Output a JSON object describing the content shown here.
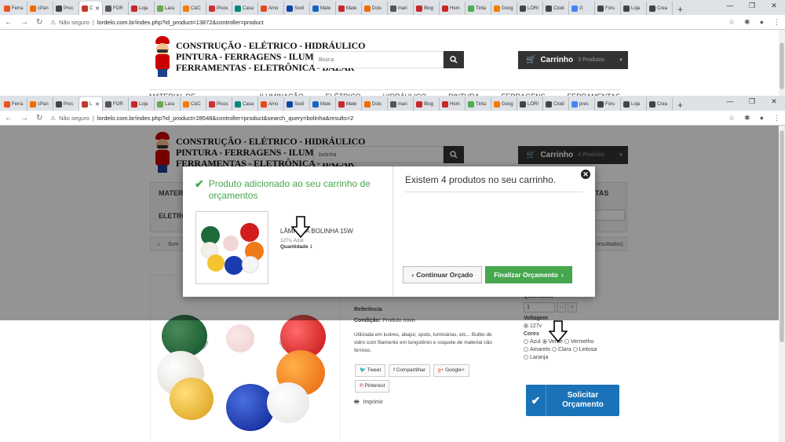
{
  "browser1": {
    "tabs": [
      {
        "label": "Ferra",
        "color": "#e8541e"
      },
      {
        "label": "cPan",
        "color": "#ef6c00"
      },
      {
        "label": "Proc",
        "color": "#444"
      },
      {
        "label": "C",
        "color": "#c0392b",
        "active": true
      },
      {
        "label": "FOR",
        "color": "#555"
      },
      {
        "label": "Loja",
        "color": "#c62828"
      },
      {
        "label": "Lara",
        "color": "#6aa84f"
      },
      {
        "label": "C&C",
        "color": "#f57c00"
      },
      {
        "label": "Pisos",
        "color": "#d32f2f"
      },
      {
        "label": "Casa",
        "color": "#00897b"
      },
      {
        "label": "Amo",
        "color": "#e64a19"
      },
      {
        "label": "Sodi",
        "color": "#0d47a1"
      },
      {
        "label": "Mate",
        "color": "#1565c0"
      },
      {
        "label": "Mate",
        "color": "#c62828"
      },
      {
        "label": "Dois",
        "color": "#ef6c00"
      },
      {
        "label": "mari",
        "color": "#555"
      },
      {
        "label": "Blog",
        "color": "#c62828"
      },
      {
        "label": "Hom",
        "color": "#c62828"
      },
      {
        "label": "Tinta",
        "color": "#4caf50"
      },
      {
        "label": "Goog",
        "color": "#f57c00"
      },
      {
        "label": "LORI",
        "color": "#444"
      },
      {
        "label": "Clodi",
        "color": "#444"
      },
      {
        "label": "G",
        "color": "#4285f4"
      },
      {
        "label": "Fóru",
        "color": "#444"
      },
      {
        "label": "Loja",
        "color": "#444"
      },
      {
        "label": "Crea",
        "color": "#444"
      }
    ],
    "insecure": "Não seguro",
    "url": "lordelo.com.br/index.php?id_product=13872&controller=product"
  },
  "browser2": {
    "tabs": [
      {
        "label": "Ferra",
        "color": "#e8541e"
      },
      {
        "label": "cPan",
        "color": "#ef6c00"
      },
      {
        "label": "Proc",
        "color": "#444"
      },
      {
        "label": "L",
        "color": "#c0392b",
        "active": true
      },
      {
        "label": "FOR",
        "color": "#555"
      },
      {
        "label": "Loja",
        "color": "#c62828"
      },
      {
        "label": "Lara",
        "color": "#6aa84f"
      },
      {
        "label": "C&C",
        "color": "#f57c00"
      },
      {
        "label": "Pisos",
        "color": "#d32f2f"
      },
      {
        "label": "Casa",
        "color": "#00897b"
      },
      {
        "label": "Amo",
        "color": "#e64a19"
      },
      {
        "label": "Sodi",
        "color": "#0d47a1"
      },
      {
        "label": "Mate",
        "color": "#1565c0"
      },
      {
        "label": "Mate",
        "color": "#c62828"
      },
      {
        "label": "Dois",
        "color": "#ef6c00"
      },
      {
        "label": "mari",
        "color": "#555"
      },
      {
        "label": "Blog",
        "color": "#c62828"
      },
      {
        "label": "Hom",
        "color": "#c62828"
      },
      {
        "label": "Tinta",
        "color": "#4caf50"
      },
      {
        "label": "Goog",
        "color": "#f57c00"
      },
      {
        "label": "LORI",
        "color": "#444"
      },
      {
        "label": "Clodi",
        "color": "#444"
      },
      {
        "label": "pres",
        "color": "#4285f4"
      },
      {
        "label": "Fóru",
        "color": "#444"
      },
      {
        "label": "Loja",
        "color": "#444"
      },
      {
        "label": "Crea",
        "color": "#444"
      }
    ],
    "insecure": "Não seguro",
    "url": "lordelo.com.br/index.php?id_product=28548&controller=product&search_query=bolinha&results=2"
  },
  "logo": {
    "line1": "CONSTRUÇÃO - ELÉTRICO - HIDRÁULICO",
    "line2": "PINTURA - FERRAGENS - ILUMINAÇÃO",
    "line3": "FERRAMENTAS - ELETRÔNICA - BAZAR"
  },
  "page1": {
    "search_placeholder": "Busca",
    "cart_label": "Carrinho",
    "cart_count": "3 Produtos",
    "menu": [
      "MATERIAL DE CONSTRUÇÃO",
      "ILUMINAÇÃO",
      "ELÉTRICO",
      "HIDRÁULICO",
      "PINTURA",
      "FERRAGENS",
      "FERRAMENTAS"
    ]
  },
  "page2": {
    "search_value": "bolinha",
    "cart_label": "Carrinho",
    "cart_count": "4 Produtos",
    "menu_left1": "MATER",
    "menu_left2": "ELETRÔ",
    "menu_right": "TAS",
    "crumb": "Ilum",
    "crumb_results": "s resultados)",
    "product_name_partial": "LÂMPADA BOLINHA 15W",
    "referencia": "Referência",
    "condicao_label": "Condição:",
    "condicao_value": "Produto novo",
    "description": "Utilizada em lustres, abajur, spots, luminárias, etc... Bulbo de vidro com filamento em tungstênio e soquete de material não ferroso.",
    "share": [
      "Tweet",
      "Compartilhar",
      "Google+",
      "Pinterest"
    ],
    "print": "Imprimir",
    "quantidade": "Quantidade",
    "qty_value": "1",
    "voltagem": "Voltagem",
    "voltage_option": "127v",
    "cores": "Cores",
    "colors": [
      "Azul",
      "Verde",
      "Vermelho",
      "Amarelo",
      "Clara",
      "Leitosa",
      "Laranja"
    ],
    "solicitar": "Solicitar Orçamento"
  },
  "modal": {
    "added": "Produto adicionado ao seu carrinho de orçamentos",
    "product_name": "LÂMPADA BOLINHA 15W",
    "attributes": "127v, Azul",
    "quantity_label": "Quantidade",
    "quantity_value": "1",
    "exist": "Existem 4 produtos no seu carrinho.",
    "continue": "Continuar Orçado",
    "finalize": "Finalizar Orçamento"
  },
  "colors": {
    "success": "#46a74e",
    "cart_bg": "#333333",
    "solicitar_bg": "#1a73b8"
  }
}
